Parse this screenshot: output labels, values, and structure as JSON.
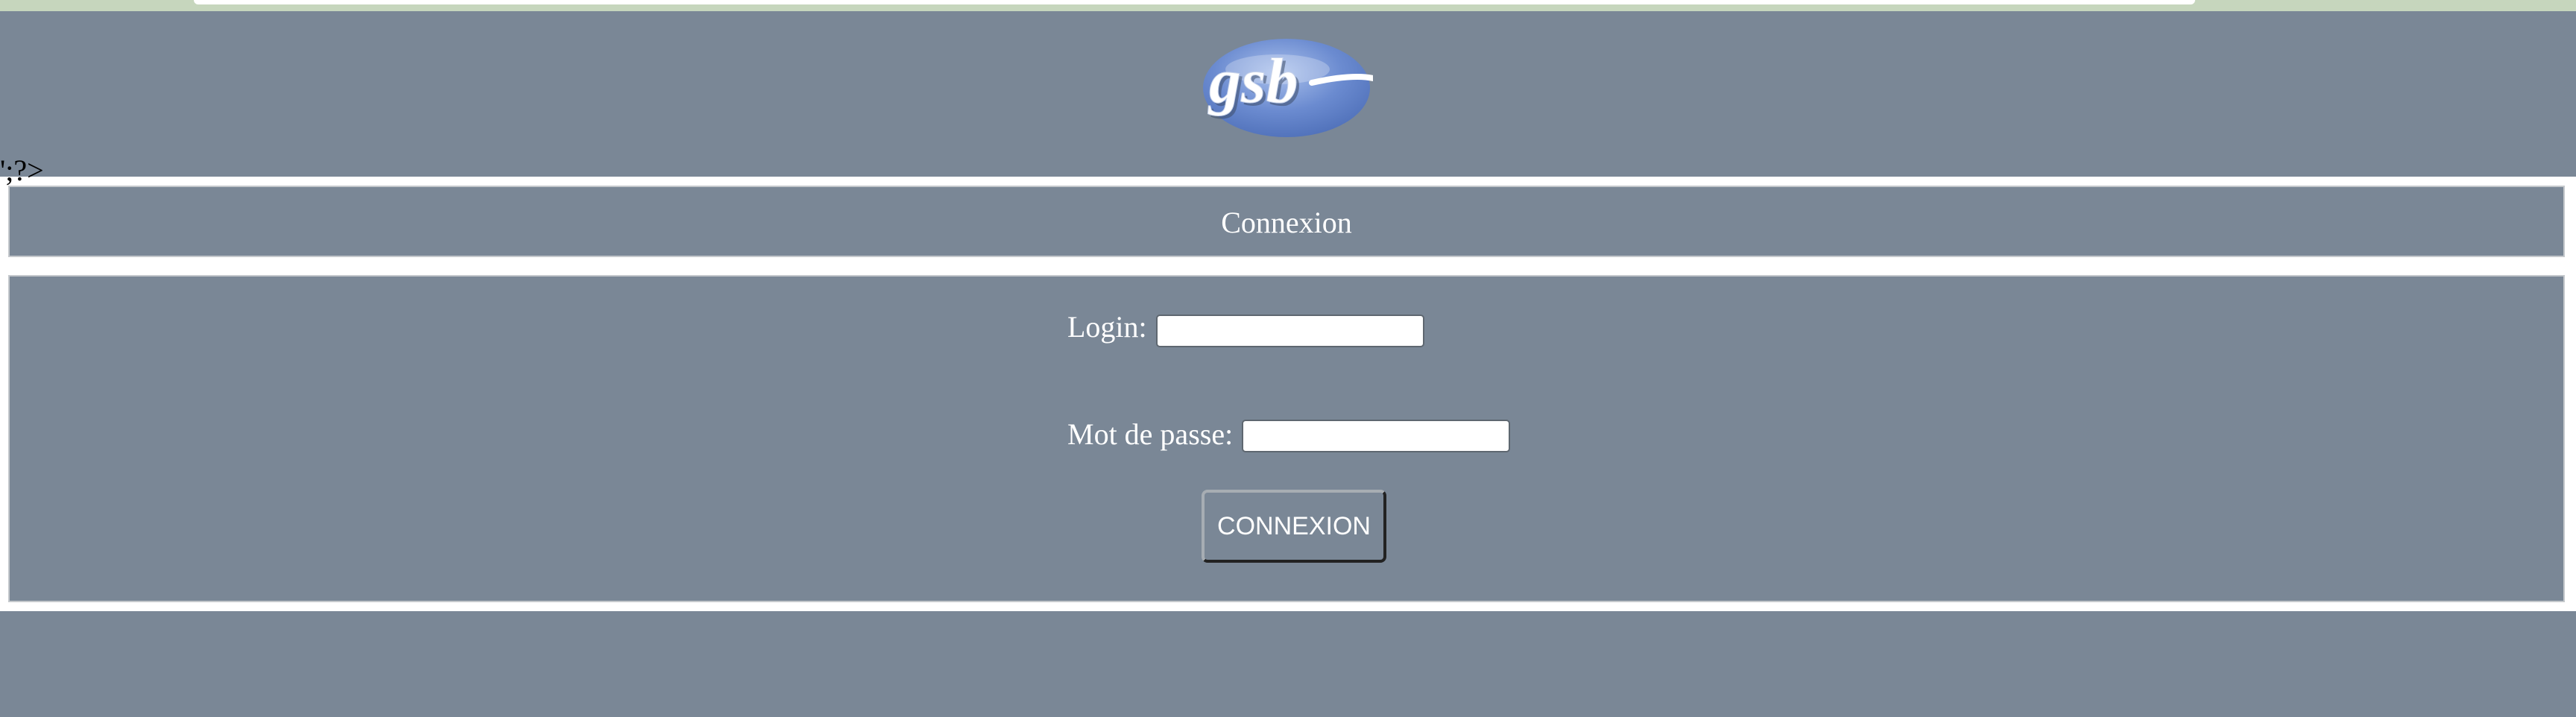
{
  "header": {
    "logo_text": "gsb",
    "stray_text": "';?>"
  },
  "page": {
    "title": "Connexion"
  },
  "form": {
    "login_label": "Login:",
    "login_value": "",
    "password_label": "Mot de passe:",
    "password_value": "",
    "submit_label": "CONNEXION"
  },
  "colors": {
    "panel_bg": "#7a8796",
    "page_bg": "#ffffff",
    "top_strip": "#c6d6bd",
    "logo_blue": "#5f7fc2",
    "text": "#ffffff"
  },
  "icons": {
    "logo": "gsb-logo"
  }
}
